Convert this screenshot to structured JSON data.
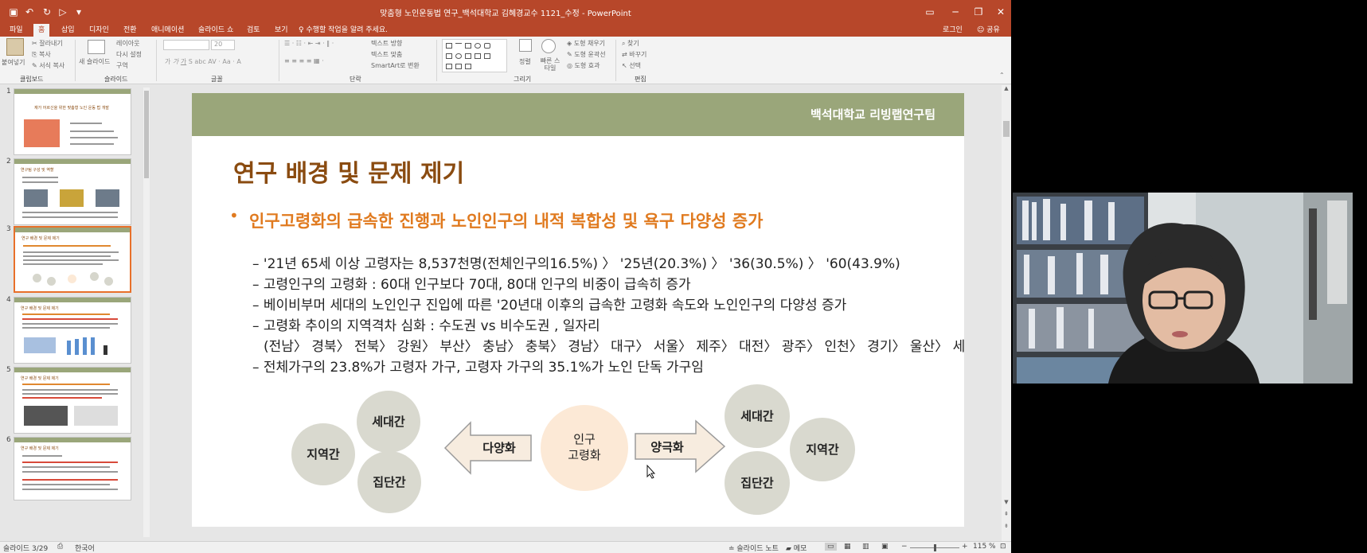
{
  "window": {
    "doc_title": "맞춤형 노인운동법 연구_백석대학교 김혜경교수 1121_수정 - PowerPoint",
    "login_label": "로그인",
    "share_label": "공유"
  },
  "tabs": [
    "파일",
    "홈",
    "삽입",
    "디자인",
    "전환",
    "애니메이션",
    "슬라이드 쇼",
    "검토",
    "보기"
  ],
  "active_tab": "홈",
  "tell_me": "수행할 작업을 알려 주세요.",
  "ribbon": {
    "clipboard": {
      "label": "클립보드",
      "paste": "붙여넣기",
      "cut": "잘라내기",
      "copy": "복사",
      "format_painter": "서식 복사"
    },
    "slides": {
      "label": "슬라이드",
      "new_slide": "새 슬라이드",
      "layout": "레이아웃",
      "reset": "다시 설정",
      "section": "구역"
    },
    "font": {
      "label": "글꼴",
      "size": "20"
    },
    "paragraph": {
      "label": "단락",
      "text_direction": "텍스트 방향",
      "align_text": "텍스트 맞춤",
      "smartart": "SmartArt로 변환"
    },
    "drawing": {
      "label": "그리기",
      "arrange": "정렬",
      "quick_styles": "빠른 스타일",
      "shape_fill": "도형 채우기",
      "shape_outline": "도형 윤곽선",
      "shape_effects": "도형 효과"
    },
    "editing": {
      "label": "편집",
      "find": "찾기",
      "replace": "바꾸기",
      "select": "선택"
    }
  },
  "thumbnails": [
    {
      "num": "1",
      "title": "재가 어르신을 위한 맞춤형 노인 운동 법 개발",
      "active": false
    },
    {
      "num": "2",
      "title": "연구팀 구성 및 역할",
      "active": false
    },
    {
      "num": "3",
      "title": "연구 배경 및 문제 제기",
      "active": true
    },
    {
      "num": "4",
      "title": "연구 배경 및 문제 제기",
      "active": false
    },
    {
      "num": "5",
      "title": "연구 배경 및 문제 제기",
      "active": false
    },
    {
      "num": "6",
      "title": "연구 배경 및 문제 제기",
      "active": false
    }
  ],
  "slide": {
    "org": "백석대학교 리빙랩연구팀",
    "title": "연구 배경 및 문제 제기",
    "bullet": "인구고령화의 급속한 진행과 노인인구의 내적 복합성 및 욕구 다양성 증가",
    "subpoints": [
      "– '21년 65세 이상 고령자는 8,537천명(전체인구의16.5%) 〉 '25년(20.3%) 〉 '36(30.5%) 〉 '60(43.9%)",
      "– 고령인구의 고령화 : 60대 인구보다 70대, 80대 인구의 비중이 급속히 증가",
      "– 베이비부머 세대의 노인인구 진입에 따른 '20년대 이후의 급속한 고령화 속도와 노인인구의 다양성 증가",
      "– 고령화 추이의 지역격차 심화 : 수도권 vs 비수도권 , 일자리",
      "(전남〉 경북〉 전북〉 강원〉 부산〉 충남〉 충북〉 경남〉 대구〉 서울〉 제주〉 대전〉 광주〉 인천〉 경기〉 울산〉 세종)",
      "– 전체가구의 23.8%가 고령자 가구, 고령자 가구의 35.1%가 노인 단독 가구임"
    ],
    "diagram": {
      "left_circles": [
        "세대간",
        "지역간",
        "집단간"
      ],
      "left_arrow": "다양화",
      "center_line1": "인구",
      "center_line2": "고령화",
      "right_arrow": "양극화",
      "right_circles": [
        "세대간",
        "지역간",
        "집단간"
      ]
    }
  },
  "status": {
    "slide_counter": "슬라이드 3/29",
    "language": "한국어",
    "notes": "슬라이드 노트",
    "comments": "메모",
    "zoom": "115 %"
  },
  "colors": {
    "ppt_accent": "#b7472a",
    "slide_header": "#9aa67a",
    "title_brown": "#8a4b10",
    "bullet_orange": "#e07a1f",
    "center_peach": "#fce9d6"
  }
}
